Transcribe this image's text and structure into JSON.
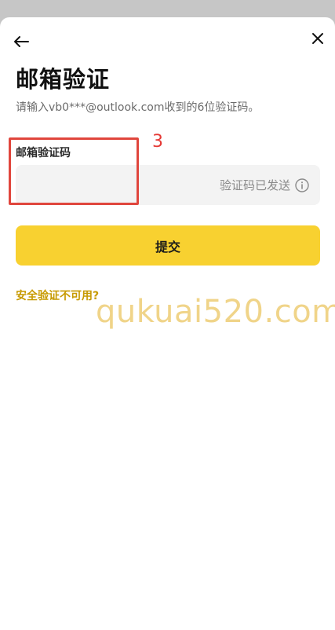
{
  "page": {
    "title": "邮箱验证",
    "subtitle": "请输入vb0***@outlook.com收到的6位验证码。"
  },
  "code_field": {
    "label": "邮箱验证码",
    "value": "",
    "status_text": "验证码已发送"
  },
  "submit": {
    "label": "提交"
  },
  "help_link": {
    "label": "安全验证不可用?"
  },
  "annotation": {
    "step_number": "3"
  },
  "watermark": {
    "text": "qukuai520.com"
  },
  "colors": {
    "accent": "#f8d130",
    "link": "#c79a00",
    "highlight": "#e0463d",
    "field_bg": "#f3f3f3"
  },
  "icons": {
    "back": "arrow-left-icon",
    "close": "close-icon",
    "info": "info-icon"
  }
}
